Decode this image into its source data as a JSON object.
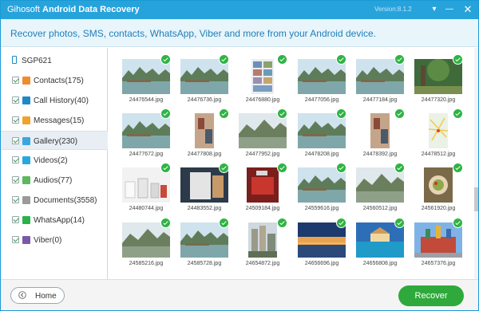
{
  "window": {
    "brand": "Gihosoft",
    "app_name": "Android Data Recovery",
    "version": "Version:8.1.2",
    "menu_icon": "chevron-down-icon",
    "minimize_icon": "minimize-icon",
    "close_icon": "close-icon"
  },
  "banner": {
    "text": "Recover photos, SMS, contacts, WhatsApp, Viber and more from your Android device."
  },
  "sidebar": {
    "device": "SGP621",
    "device_icon": "phone-icon",
    "items": [
      {
        "label": "Contacts(175)",
        "icon": "contacts-icon",
        "color": "#f28b2c",
        "checked": true,
        "active": false
      },
      {
        "label": "Call History(40)",
        "icon": "call-history-icon",
        "color": "#1e88c8",
        "checked": true,
        "active": false
      },
      {
        "label": "Messages(15)",
        "icon": "messages-icon",
        "color": "#f2a12c",
        "checked": true,
        "active": false
      },
      {
        "label": "Gallery(230)",
        "icon": "gallery-icon",
        "color": "#3aa6e0",
        "checked": true,
        "active": true
      },
      {
        "label": "Videos(2)",
        "icon": "videos-icon",
        "color": "#28a8e0",
        "checked": true,
        "active": false
      },
      {
        "label": "Audios(77)",
        "icon": "audios-icon",
        "color": "#5cb85c",
        "checked": true,
        "active": false
      },
      {
        "label": "Documents(3558)",
        "icon": "documents-icon",
        "color": "#9a9a9a",
        "checked": true,
        "active": false
      },
      {
        "label": "WhatsApp(14)",
        "icon": "whatsapp-icon",
        "color": "#29b34a",
        "checked": true,
        "active": false
      },
      {
        "label": "Viber(0)",
        "icon": "viber-icon",
        "color": "#7a5aa6",
        "checked": true,
        "active": false
      }
    ]
  },
  "gallery": {
    "photos": [
      {
        "name": "24476544.jpg",
        "scene": "lake",
        "checked": true
      },
      {
        "name": "24476736.jpg",
        "scene": "lake",
        "checked": true
      },
      {
        "name": "24476880.jpg",
        "scene": "screenshot",
        "checked": true
      },
      {
        "name": "24477056.jpg",
        "scene": "lake",
        "checked": true
      },
      {
        "name": "24477184.jpg",
        "scene": "lake",
        "checked": true
      },
      {
        "name": "24477320.jpg",
        "scene": "forest",
        "checked": true
      },
      {
        "name": "24477672.jpg",
        "scene": "lake",
        "checked": true
      },
      {
        "name": "24477808.jpg",
        "scene": "indoor",
        "checked": true
      },
      {
        "name": "24477952.jpg",
        "scene": "hills",
        "checked": true
      },
      {
        "name": "24478208.jpg",
        "scene": "lake",
        "checked": true
      },
      {
        "name": "24478392.jpg",
        "scene": "indoor",
        "checked": true
      },
      {
        "name": "24478512.jpg",
        "scene": "map",
        "checked": true
      },
      {
        "name": "24480744.jpg",
        "scene": "product",
        "checked": true
      },
      {
        "name": "24483552.jpg",
        "scene": "box",
        "checked": true
      },
      {
        "name": "24509184.jpg",
        "scene": "red",
        "checked": true
      },
      {
        "name": "24559616.jpg",
        "scene": "lake",
        "checked": true
      },
      {
        "name": "24560512.jpg",
        "scene": "hills",
        "checked": true
      },
      {
        "name": "24561920.jpg",
        "scene": "food",
        "checked": true
      },
      {
        "name": "24585216.jpg",
        "scene": "hills",
        "checked": true
      },
      {
        "name": "24585728.jpg",
        "scene": "lake",
        "checked": true
      },
      {
        "name": "24654872.jpg",
        "scene": "city",
        "checked": true
      },
      {
        "name": "24656696.jpg",
        "scene": "dusk",
        "checked": true
      },
      {
        "name": "24656808.jpg",
        "scene": "sea",
        "checked": true
      },
      {
        "name": "24657376.jpg",
        "scene": "castle",
        "checked": true
      }
    ]
  },
  "footer": {
    "home_label": "Home",
    "home_icon": "arrow-left-icon",
    "recover_label": "Recover"
  },
  "colors": {
    "titlebar": "#27a3dc",
    "accent": "#1f7fb8",
    "recover": "#2fa93c",
    "check": "#2fb344"
  }
}
